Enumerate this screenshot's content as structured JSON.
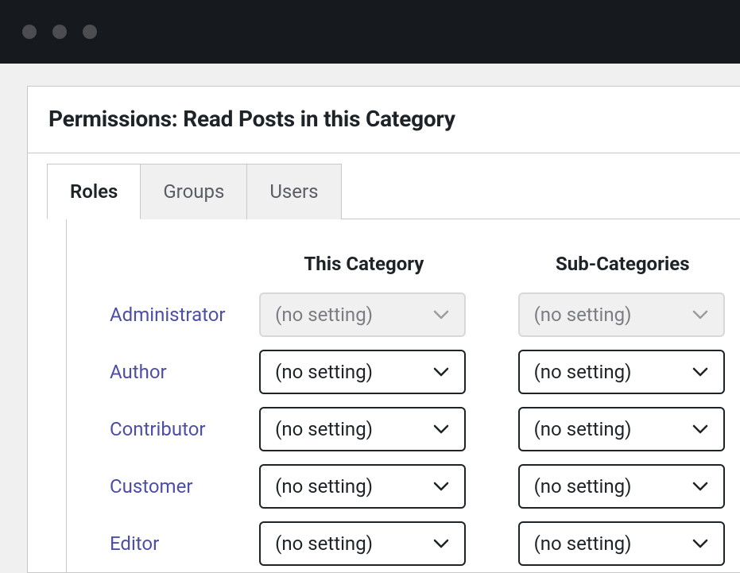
{
  "panel": {
    "title": "Permissions: Read Posts in this Category"
  },
  "tabs": [
    {
      "label": "Roles",
      "active": true
    },
    {
      "label": "Groups",
      "active": false
    },
    {
      "label": "Users",
      "active": false
    }
  ],
  "columns": {
    "this_category": "This Category",
    "sub_categories": "Sub-Categories"
  },
  "no_setting_label": "(no setting)",
  "roles": [
    {
      "name": "Administrator",
      "this_category": "(no setting)",
      "sub_categories": "(no setting)",
      "disabled": true
    },
    {
      "name": "Author",
      "this_category": "(no setting)",
      "sub_categories": "(no setting)",
      "disabled": false
    },
    {
      "name": "Contributor",
      "this_category": "(no setting)",
      "sub_categories": "(no setting)",
      "disabled": false
    },
    {
      "name": "Customer",
      "this_category": "(no setting)",
      "sub_categories": "(no setting)",
      "disabled": false
    },
    {
      "name": "Editor",
      "this_category": "(no setting)",
      "sub_categories": "(no setting)",
      "disabled": false
    }
  ]
}
